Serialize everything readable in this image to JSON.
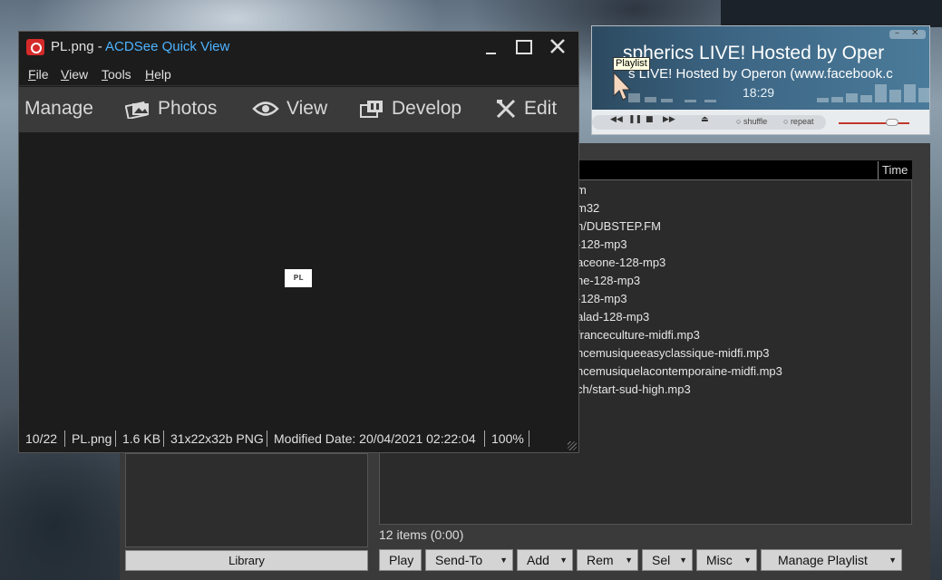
{
  "player": {
    "title_big": "spherics LIVE! Hosted by Oper",
    "title_small": "s LIVE! Hosted by Operon (www.facebook.c",
    "time": "18:29",
    "shuffle_label": "shuffle",
    "repeat_label": "repeat",
    "tooltip": "Playlist"
  },
  "acdsee": {
    "title_file": "PL.png - ",
    "title_app": "ACDSee Quick View",
    "menu": [
      "File",
      "View",
      "Tools",
      "Help"
    ],
    "menu_underline": [
      "F",
      "V",
      "T",
      "H"
    ],
    "menu_rest": [
      "ile",
      "iew",
      "ools",
      "elp"
    ],
    "modes": [
      "Manage",
      "Photos",
      "View",
      "Develop",
      "Edit"
    ],
    "image_label": "PL",
    "status": {
      "index": "10/22",
      "filename": "PL.png",
      "size": "1.6 KB",
      "dimensions": "31x22x32b PNG",
      "modified": "Modified Date: 20/04/2021 02:22:04",
      "zoom": "100%"
    }
  },
  "playlist": {
    "time_header": "Time",
    "items": [
      "m",
      "m32",
      "n/DUBSTEP.FM",
      "-128-mp3",
      "aceone-128-mp3",
      "ne-128-mp3",
      "-128-mp3",
      "alad-128-mp3",
      "franceculture-midfi.mp3",
      "ncemusiqueeasyclassique-midfi.mp3",
      "ncemusiquelacontemporaine-midfi.mp3",
      "ch/start-sud-high.mp3"
    ],
    "status": "12 items (0:00)",
    "library_button": "Library",
    "buttons": {
      "play": "Play",
      "send_to": "Send-To",
      "add": "Add",
      "rem": "Rem",
      "sel": "Sel",
      "misc": "Misc",
      "manage": "Manage Playlist"
    }
  }
}
